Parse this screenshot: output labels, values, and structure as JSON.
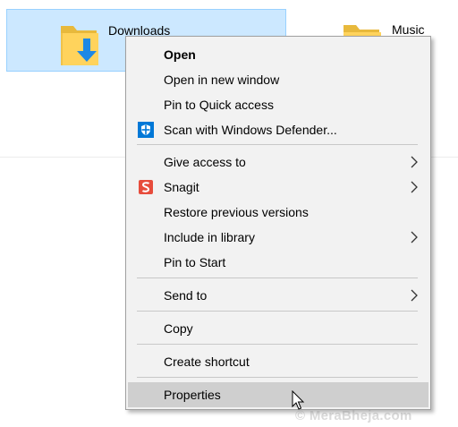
{
  "explorer": {
    "folders": [
      {
        "name": "Downloads",
        "icon": "folder-download-icon",
        "selected": true
      },
      {
        "name": "Music",
        "icon": "folder-music-icon",
        "selected": false
      }
    ]
  },
  "context_menu": {
    "items": [
      {
        "label": "Open",
        "bold": true
      },
      {
        "label": "Open in new window"
      },
      {
        "label": "Pin to Quick access"
      },
      {
        "label": "Scan with Windows Defender...",
        "icon": "windows-defender-shield-icon"
      },
      {
        "label": "Give access to",
        "submenu": true
      },
      {
        "label": "Snagit",
        "icon": "snagit-icon",
        "submenu": true
      },
      {
        "label": "Restore previous versions"
      },
      {
        "label": "Include in library",
        "submenu": true
      },
      {
        "label": "Pin to Start"
      },
      {
        "label": "Send to",
        "submenu": true
      },
      {
        "label": "Copy"
      },
      {
        "label": "Create shortcut"
      },
      {
        "label": "Properties",
        "highlighted": true
      }
    ]
  },
  "watermark": "© MeraBheja.com",
  "colors": {
    "selection_bg": "#cce8ff",
    "selection_border": "#99d1ff",
    "menu_bg": "#f2f2f2",
    "menu_hover": "#cfcfcf",
    "folder_yellow": "#ffd35c",
    "download_arrow_blue": "#1e88e5",
    "defender_blue": "#0078d7",
    "snagit_red": "#e74c3c"
  }
}
